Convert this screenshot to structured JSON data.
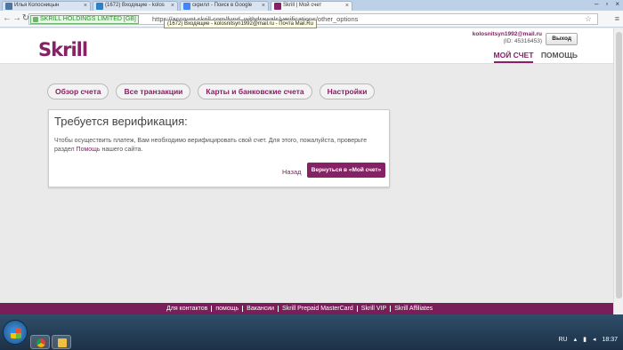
{
  "browser": {
    "tabs": [
      {
        "label": "Илья Колосницын",
        "icon_color": "#4c75a3"
      },
      {
        "label": "(1672) Входящие - kolos",
        "icon_color": "#2c82c9"
      },
      {
        "label": "скрилл - Поиск в Google",
        "icon_color": "#4285f4"
      },
      {
        "label": "Skrill | Мой счет",
        "icon_color": "#862165"
      }
    ],
    "ev_label": "SKRILL HOLDINGS LIMITED [GB]",
    "url_text": "https://account.skrill.com/fund_withdrawals/verifications/other_options",
    "tooltip": "(1672) Входящие - kolosnitsyn1992@mail.ru - Почта Mail.Ru"
  },
  "header": {
    "logo": "Skrill",
    "user_email": "kolosnitsyn1992@mail.ru",
    "user_id": "(ID: 45316453)",
    "logout": "Выход",
    "nav": [
      "МОЙ СЧЕТ",
      "ПОМОЩЬ"
    ]
  },
  "tabs": [
    "Обзор счета",
    "Все транзакции",
    "Карты и банковские счета",
    "Настройки"
  ],
  "card": {
    "title": "Требуется верификация:",
    "body_prefix": "Чтобы осуществить платеж, Вам необходимо верифицировать свой счет. Для этого, пожалуйста, проверьте раздел ",
    "body_link": "Помощь",
    "body_suffix": " нашего сайта.",
    "back": "Назад",
    "return_button": "Вернуться в «Мой счет»"
  },
  "footer": {
    "links": [
      "Для контактов",
      "помощь",
      "Вакансии",
      "Skrill Prepaid MasterCard",
      "Skrill VIP",
      "Skrill Affiliates"
    ]
  },
  "taskbar": {
    "language": "RU",
    "time": "18:37"
  },
  "colors": {
    "brand": "#862165",
    "footer": "#7a1e5a"
  }
}
